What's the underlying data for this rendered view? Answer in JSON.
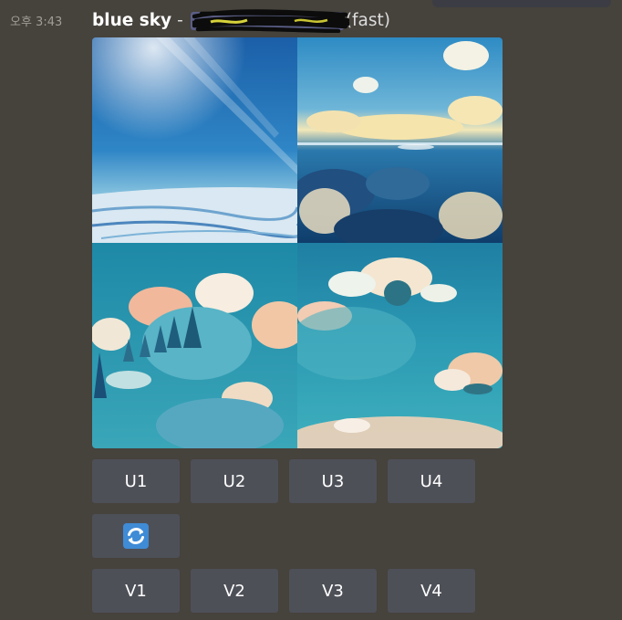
{
  "message": {
    "timestamp": "오후 3:43",
    "prompt": "blue sky",
    "separator": "-",
    "speed": "(fast)"
  },
  "image_grid": {
    "tiles": [
      {
        "name": "grid-image-1",
        "description": "sky with light rays over snowy ground"
      },
      {
        "name": "grid-image-2",
        "description": "sunset clouds over a sea of clouds"
      },
      {
        "name": "grid-image-3",
        "description": "clouds with dark trees"
      },
      {
        "name": "grid-image-4",
        "description": "cloudy teal sky"
      }
    ]
  },
  "buttons": {
    "upscale": [
      "U1",
      "U2",
      "U3",
      "U4"
    ],
    "reroll_icon": "reroll-icon",
    "variation": [
      "V1",
      "V2",
      "V3",
      "V4"
    ]
  },
  "colors": {
    "background": "#46423c",
    "button": "#4e5058",
    "reroll": "#3f8bd6",
    "mention": "#5b5e87"
  }
}
